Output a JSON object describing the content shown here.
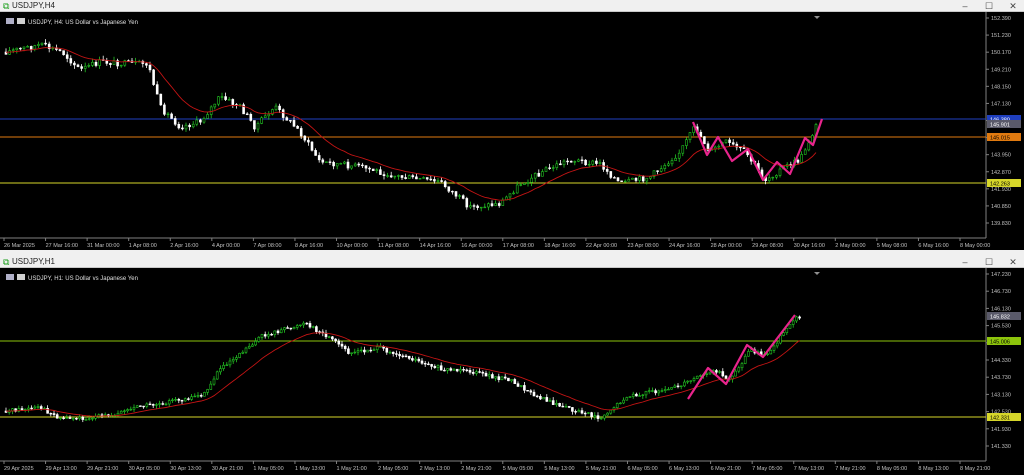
{
  "top_window": {
    "title": "USDJPY,H4",
    "controls": {
      "minimize": "–",
      "maximize": "☐",
      "close": "✕"
    },
    "chart_label": "USDJPY, H4:  US Dollar vs Japanese Yen",
    "price_scale": [
      "152.390",
      "151.230",
      "150.170",
      "149.210",
      "148.150",
      "147.130",
      "146.070",
      "145.010",
      "143.950",
      "142.870",
      "141.930",
      "140.850",
      "139.830"
    ],
    "price_tags": {
      "blue_line": "146.380",
      "current": "145.901",
      "orange_line": "145.015",
      "yellow_line": "142.263"
    },
    "time_axis": [
      "26 Mar 2025",
      "27 Mar 16:00",
      "31 Mar 00:00",
      "1 Apr 08:00",
      "2 Apr 16:00",
      "4 Apr 00:00",
      "7 Apr 08:00",
      "8 Apr 16:00",
      "10 Apr 00:00",
      "11 Apr 08:00",
      "14 Apr 16:00",
      "16 Apr 00:00",
      "17 Apr 08:00",
      "18 Apr 16:00",
      "22 Apr 00:00",
      "23 Apr 08:00",
      "24 Apr 16:00",
      "28 Apr 00:00",
      "29 Apr 08:00",
      "30 Apr 16:00",
      "2 May 00:00",
      "5 May 08:00",
      "6 May 16:00",
      "8 May 00:00"
    ],
    "pattern_marker": "W"
  },
  "bottom_window": {
    "title": "USDJPY,H1",
    "controls": {
      "minimize": "–",
      "maximize": "☐",
      "close": "✕"
    },
    "chart_label": "USDJPY, H1:  US Dollar vs Japanese Yen",
    "price_scale": [
      "147.230",
      "146.730",
      "146.130",
      "145.530",
      "144.930",
      "144.330",
      "143.730",
      "143.130",
      "142.530",
      "141.930",
      "141.330"
    ],
    "price_tags": {
      "current": "145.832",
      "green_line": "145.006",
      "yellow_line": "142.331"
    },
    "time_axis": [
      "29 Apr 2025",
      "29 Apr 13:00",
      "29 Apr 21:00",
      "30 Apr 05:00",
      "30 Apr 13:00",
      "30 Apr 21:00",
      "1 May 05:00",
      "1 May 13:00",
      "1 May 21:00",
      "2 May 05:00",
      "2 May 13:00",
      "2 May 21:00",
      "5 May 05:00",
      "5 May 13:00",
      "5 May 21:00",
      "6 May 05:00",
      "6 May 13:00",
      "6 May 21:00",
      "7 May 05:00",
      "7 May 13:00",
      "7 May 21:00",
      "8 May 05:00",
      "8 May 13:00",
      "8 May 21:00"
    ],
    "pattern_marker": "W"
  },
  "colors": {
    "bull": "#22c522",
    "bear": "#ffffff",
    "ma": "#c41414",
    "blue_line": "#1f3fbf",
    "orange_line": "#e07a10",
    "yellow_line": "#d6d62a",
    "green_line": "#8dc40c",
    "pattern": "#e8248c",
    "grid_text": "#c0c0c0"
  }
}
